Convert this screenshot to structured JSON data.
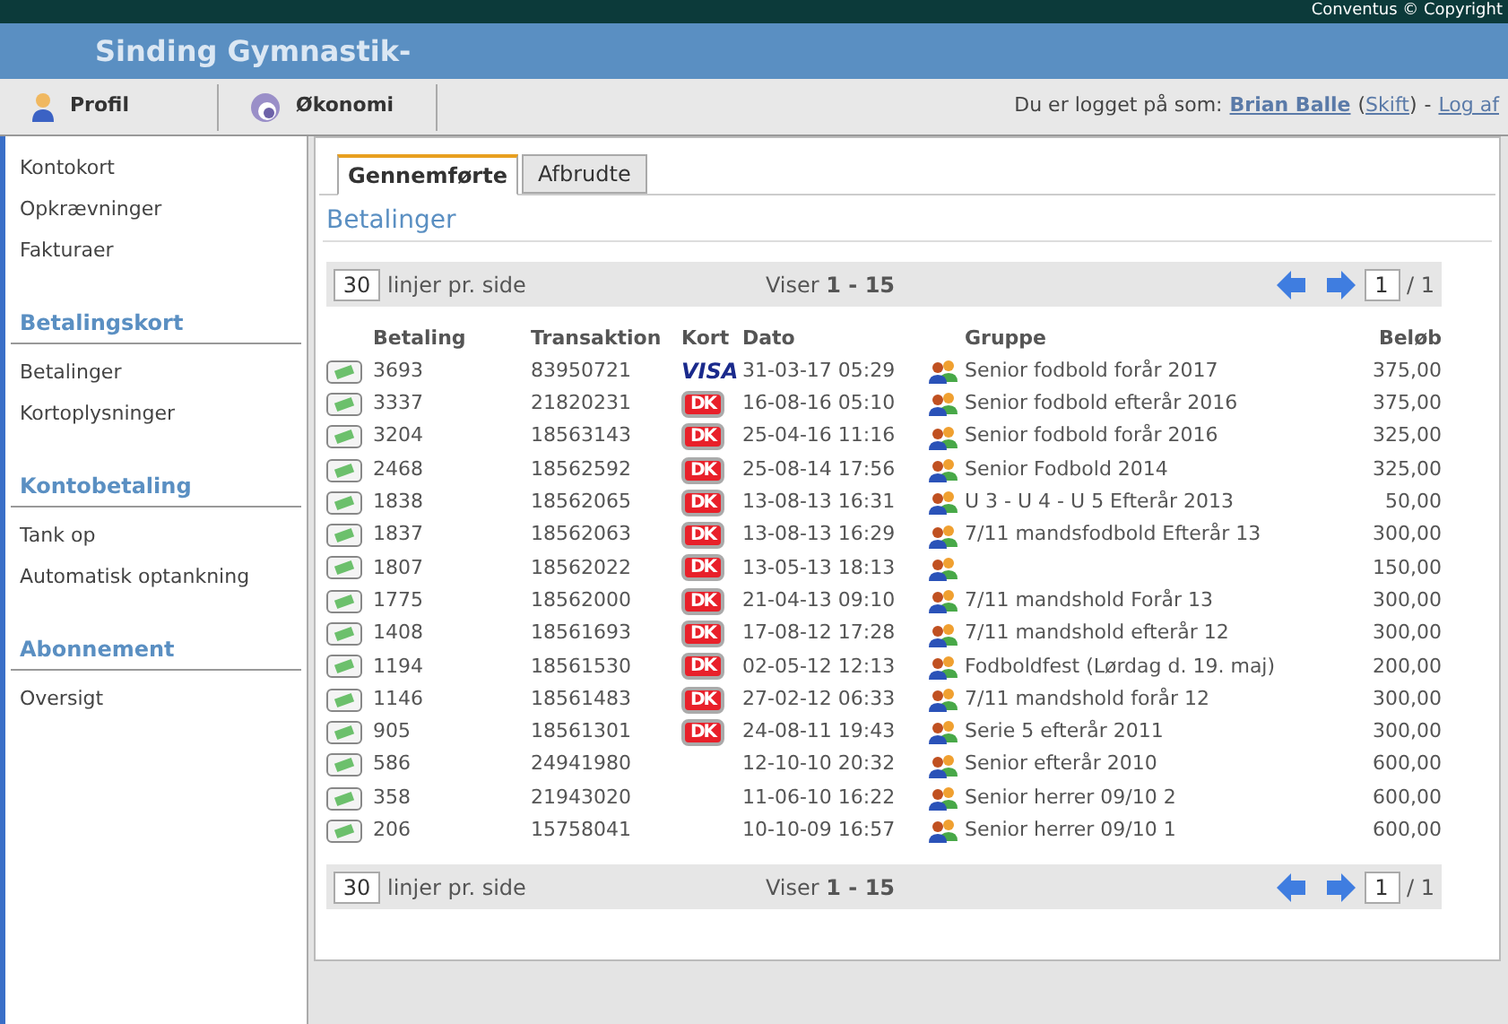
{
  "copyright": "Conventus © Copyright",
  "site_title": "Sinding Gymnastik-",
  "nav": [
    {
      "label": "Profil",
      "kind": "person"
    },
    {
      "label": "Økonomi",
      "kind": "swirl"
    }
  ],
  "login": {
    "prefix": "Du er logget på som:",
    "user": "Brian Balle",
    "open_paren": "(",
    "switch": "Skift",
    "close_paren": ")",
    "separator": "-",
    "logout": "Log af"
  },
  "sidebar": [
    {
      "items": [
        "Kontokort",
        "Opkrævninger",
        "Fakturaer"
      ]
    },
    {
      "heading": "Betalingskort",
      "items": [
        "Betalinger",
        "Kortoplysninger"
      ]
    },
    {
      "heading": "Kontobetaling",
      "items": [
        "Tank op",
        "Automatisk optankning"
      ]
    },
    {
      "heading": "Abonnement",
      "items": [
        "Oversigt"
      ]
    }
  ],
  "tabs": [
    {
      "label": "Gennemførte",
      "selected": true
    },
    {
      "label": "Afbrudte",
      "selected": false
    }
  ],
  "section_title": "Betalinger",
  "pagers": [
    {
      "per_page": "30",
      "per_page_label": "linjer pr. side",
      "showing": "Viser **1 - 15**",
      "page": "1",
      "total": "/ 1"
    },
    {
      "per_page": "30",
      "per_page_label": "linjer pr. side",
      "showing": "Viser **1 - 15**",
      "page": "1",
      "total": "/ 1"
    }
  ],
  "columns": [
    "Betaling",
    "Transaktion",
    "Kort",
    "Dato",
    "Gruppe",
    "Beløb"
  ],
  "rows": [
    {
      "id": "3693",
      "tx": "83950721",
      "card": {
        "kind": "visa",
        "label": "VISA"
      },
      "date": "31-03-17 05:29",
      "group": "Senior fodbold forår 2017",
      "amount": "375,00"
    },
    {
      "id": "3337",
      "tx": "21820231",
      "card": {
        "kind": "dankort",
        "label": "DK"
      },
      "date": "16-08-16 05:10",
      "group": "Senior fodbold efterår 2016",
      "amount": "375,00"
    },
    {
      "id": "3204",
      "tx": "18563143",
      "card": {
        "kind": "dankort",
        "label": "DK"
      },
      "date": "25-04-16 11:16",
      "group": "Senior fodbold forår 2016",
      "amount": "325,00"
    },
    {
      "id": "2468",
      "tx": "18562592",
      "card": {
        "kind": "dankort",
        "label": "DK"
      },
      "date": "25-08-14 17:56",
      "group": "Senior Fodbold 2014",
      "amount": "325,00"
    },
    {
      "id": "1838",
      "tx": "18562065",
      "card": {
        "kind": "dankort",
        "label": "DK"
      },
      "date": "13-08-13 16:31",
      "group": "U 3 - U 4 - U 5 Efterår 2013",
      "amount": "50,00"
    },
    {
      "id": "1837",
      "tx": "18562063",
      "card": {
        "kind": "dankort",
        "label": "DK"
      },
      "date": "13-08-13 16:29",
      "group": "7/11 mandsfodbold Efterår 13",
      "amount": "300,00"
    },
    {
      "id": "1807",
      "tx": "18562022",
      "card": {
        "kind": "dankort",
        "label": "DK"
      },
      "date": "13-05-13 18:13",
      "group": null,
      "amount": "150,00"
    },
    {
      "id": "1775",
      "tx": "18562000",
      "card": {
        "kind": "dankort",
        "label": "DK"
      },
      "date": "21-04-13 09:10",
      "group": "7/11 mandshold Forår 13",
      "amount": "300,00"
    },
    {
      "id": "1408",
      "tx": "18561693",
      "card": {
        "kind": "dankort",
        "label": "DK"
      },
      "date": "17-08-12 17:28",
      "group": "7/11 mandshold efterår 12",
      "amount": "300,00"
    },
    {
      "id": "1194",
      "tx": "18561530",
      "card": {
        "kind": "dankort",
        "label": "DK"
      },
      "date": "02-05-12 12:13",
      "group": "Fodboldfest (Lørdag d. 19. maj)",
      "amount": "200,00"
    },
    {
      "id": "1146",
      "tx": "18561483",
      "card": {
        "kind": "dankort",
        "label": "DK"
      },
      "date": "27-02-12 06:33",
      "group": "7/11 mandshold forår 12",
      "amount": "300,00"
    },
    {
      "id": "905",
      "tx": "18561301",
      "card": {
        "kind": "dankort",
        "label": "DK"
      },
      "date": "24-08-11 19:43",
      "group": "Serie 5 efterår 2011",
      "amount": "300,00"
    },
    {
      "id": "586",
      "tx": "24941980",
      "card": {
        "kind": "none"
      },
      "date": "12-10-10 20:32",
      "group": "Senior efterår 2010",
      "amount": "600,00"
    },
    {
      "id": "358",
      "tx": "21943020",
      "card": {
        "kind": "none"
      },
      "date": "11-06-10 16:22",
      "group": "Senior herrer 09/10 2",
      "amount": "600,00"
    },
    {
      "id": "206",
      "tx": "15758041",
      "card": {
        "kind": "none"
      },
      "date": "10-10-09 16:57",
      "group": "Senior herrer 09/10 1",
      "amount": "600,00"
    }
  ]
}
